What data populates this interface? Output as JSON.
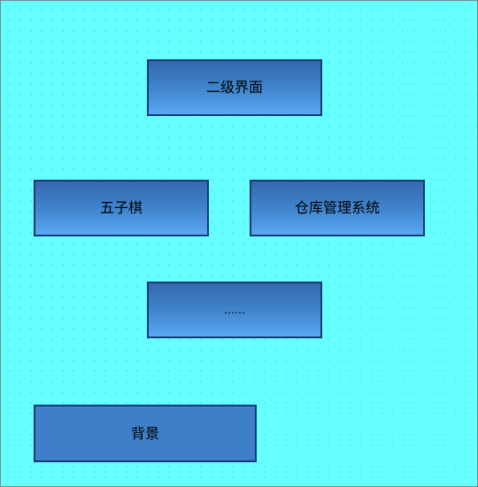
{
  "diagram": {
    "nodes": [
      {
        "id": "secondary",
        "label": "二级界面"
      },
      {
        "id": "gomoku",
        "label": "五子棋"
      },
      {
        "id": "warehouse",
        "label": "仓库管理系统"
      },
      {
        "id": "ellipsis",
        "label": "……"
      },
      {
        "id": "background",
        "label": "背景"
      }
    ]
  },
  "colors": {
    "canvas": "#66ffff",
    "box_border": "#123a78",
    "box_top": "#3568ad",
    "box_bottom": "#5aa7f2",
    "box_flat": "#3f7fc9"
  }
}
